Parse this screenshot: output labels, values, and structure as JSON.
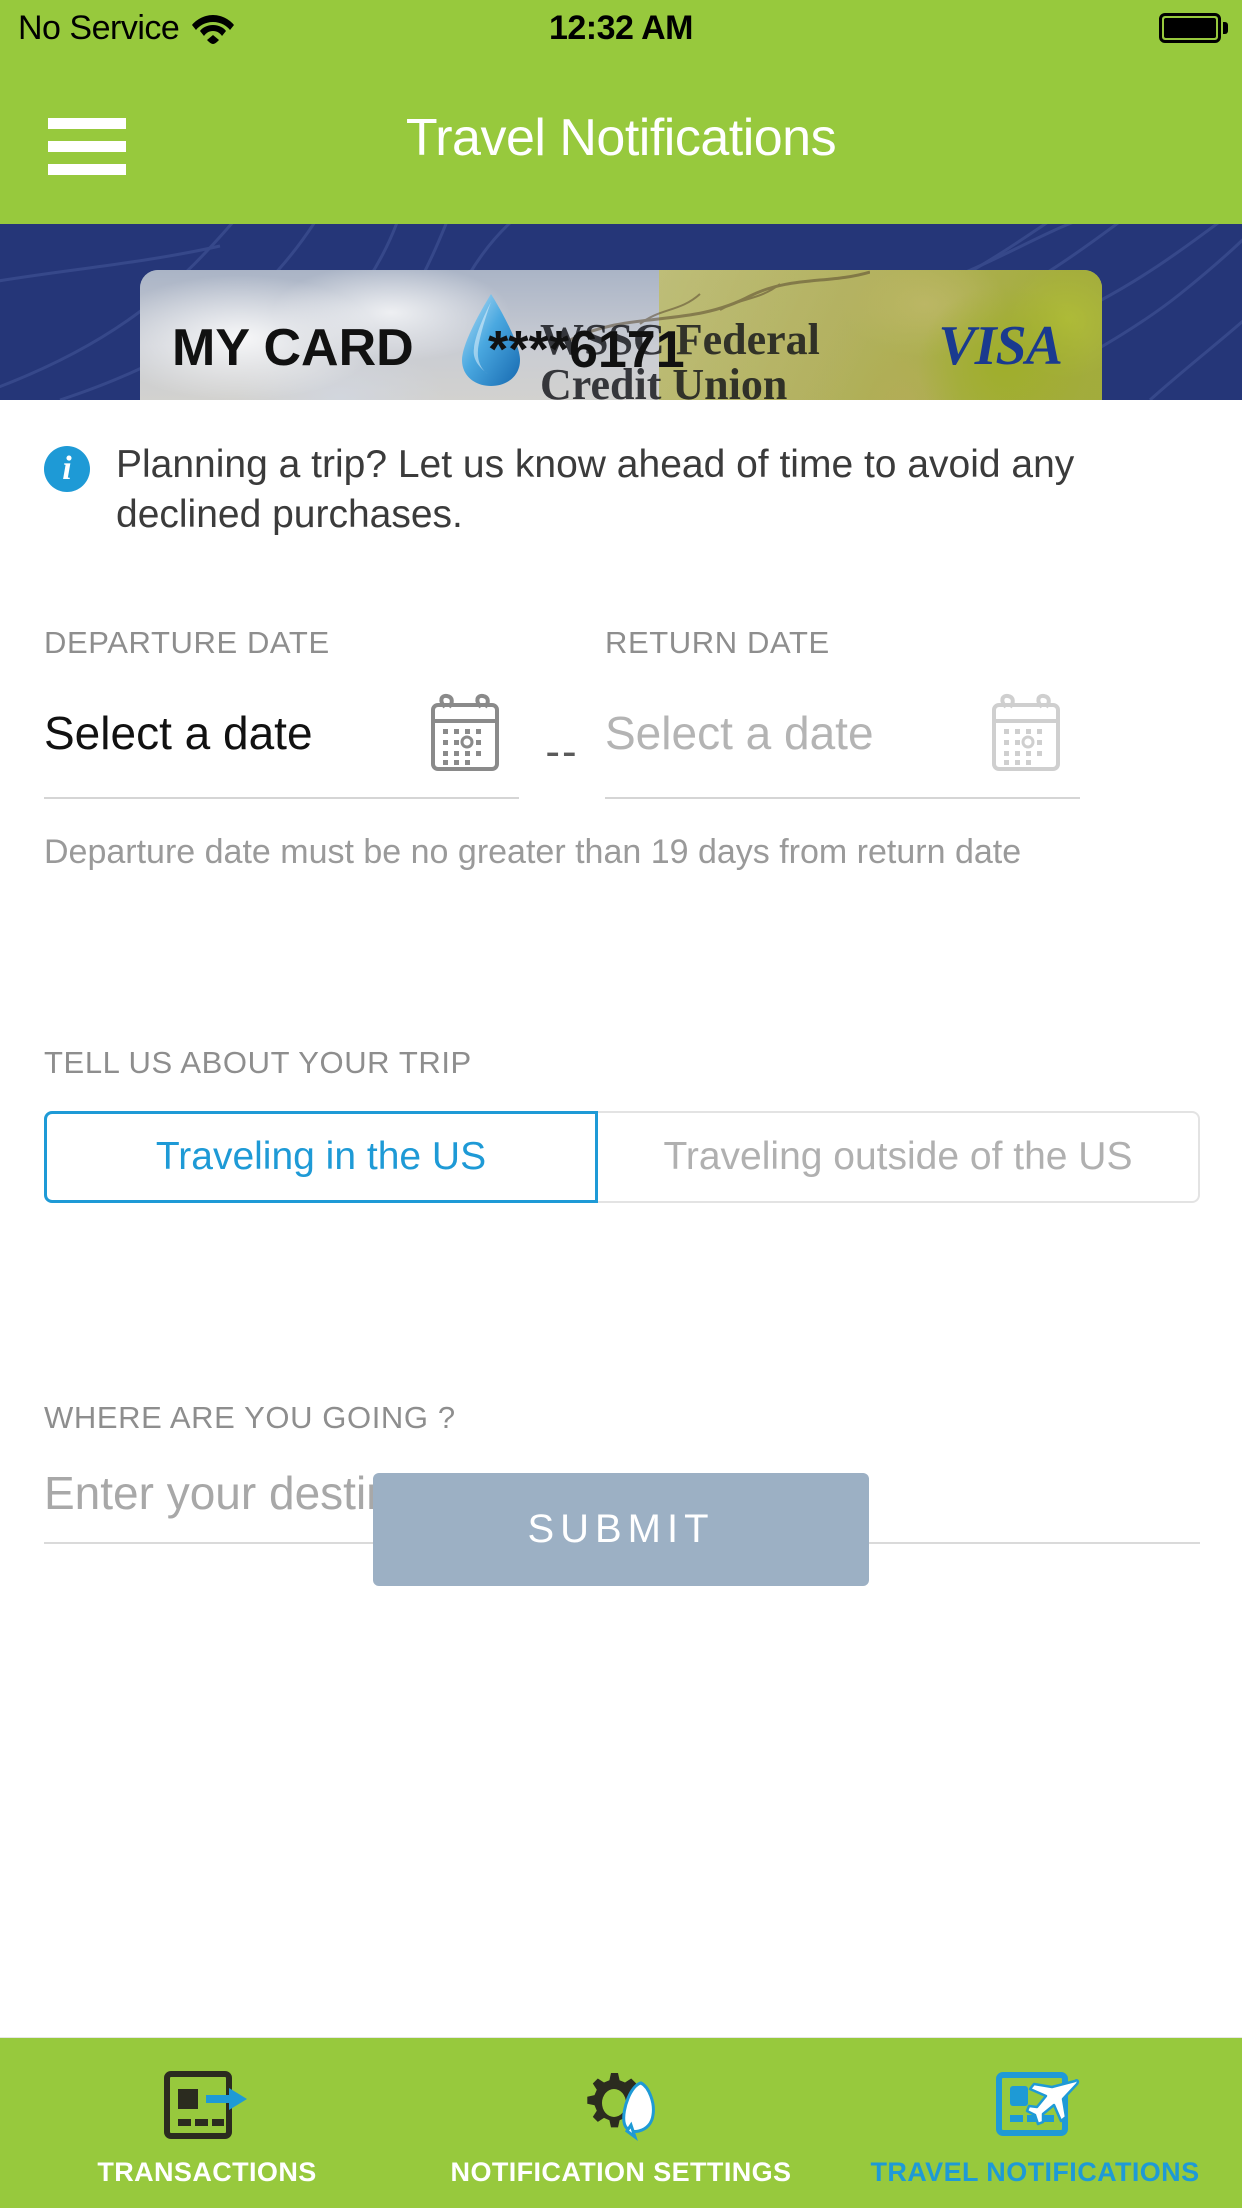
{
  "status_bar": {
    "carrier": "No Service",
    "time": "12:32 AM",
    "wifi_icon": "wifi-icon",
    "battery_icon": "battery-full-icon"
  },
  "nav": {
    "menu_icon": "hamburger-menu-icon",
    "title": "Travel Notifications"
  },
  "card": {
    "label": "MY CARD",
    "masked_number": "****6171",
    "network": "VISA",
    "issuer_line1": "WSSC Federal",
    "issuer_line2": "Credit Union",
    "logo_icon": "water-droplet-icon",
    "banner_color": "#253678"
  },
  "info": {
    "icon": "info-circle-icon",
    "message": "Planning a trip? Let us know ahead of time to avoid any declined purchases."
  },
  "dates": {
    "departure_label": "DEPARTURE DATE",
    "return_label": "RETURN DATE",
    "departure_value": "Select a date",
    "return_value": "Select a date",
    "separator": "--",
    "calendar_icon": "calendar-icon",
    "hint": "Departure date must be no greater than 19 days from return date"
  },
  "trip": {
    "label": "TELL US ABOUT YOUR TRIP",
    "options": [
      {
        "label": "Traveling in the US",
        "selected": true
      },
      {
        "label": "Traveling outside of the US",
        "selected": false
      }
    ]
  },
  "destination": {
    "label": "WHERE ARE YOU GOING ?",
    "placeholder": "Enter your destination",
    "value": ""
  },
  "submit": {
    "label": "SUBMIT",
    "enabled": false,
    "color": "#9cb0c4"
  },
  "tabs": [
    {
      "label": "TRANSACTIONS",
      "icon": "card-arrow-icon",
      "active": false
    },
    {
      "label": "NOTIFICATION SETTINGS",
      "icon": "gear-bell-icon",
      "active": false
    },
    {
      "label": "TRAVEL NOTIFICATIONS",
      "icon": "card-airplane-icon",
      "active": true
    }
  ],
  "theme": {
    "brand_green": "#97c93d",
    "brand_navy": "#253678",
    "accent_blue": "#1e9ad6"
  }
}
